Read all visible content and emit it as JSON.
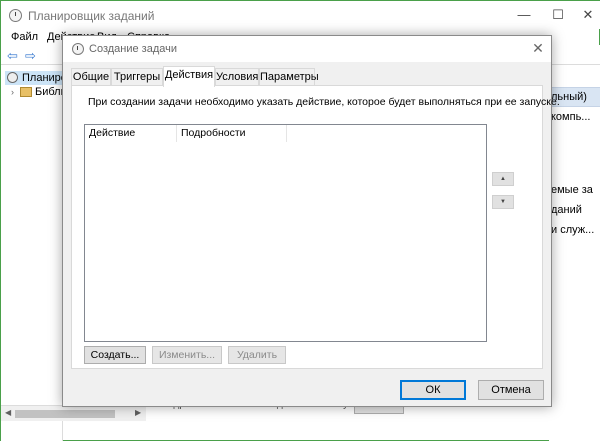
{
  "main_window": {
    "title": "Планировщик заданий",
    "menu": [
      "Файл",
      "Действие",
      "Вид",
      "Справка"
    ],
    "tree_root": "Планировщик",
    "tree_library": "Библиотека",
    "right_pane": {
      "header": "льный)",
      "items": [
        "компь...",
        "емые за",
        "даний",
        "и служ..."
      ]
    },
    "bottom_text": "Подробная статистика о действиях запуска..."
  },
  "dialog": {
    "title": "Создание задачи",
    "tabs": [
      {
        "label": "Общие"
      },
      {
        "label": "Триггеры"
      },
      {
        "label": "Действия"
      },
      {
        "label": "Условия"
      },
      {
        "label": "Параметры"
      }
    ],
    "active_tab": "Действия",
    "description": "При создании задачи необходимо указать действие, которое будет выполняться при ее запуске.",
    "list": {
      "columns": [
        "Действие",
        "Подробности"
      ],
      "rows": []
    },
    "actions": {
      "create": "Создать...",
      "edit": "Изменить...",
      "delete": "Удалить"
    },
    "ok": "ОК",
    "cancel": "Отмена"
  },
  "icons": {
    "up": "move-up-icon",
    "down": "move-down-icon",
    "close": "close-icon"
  },
  "colors": {
    "accent": "#0078d7",
    "tab_panel": "#ffffff",
    "dialog_bg": "#f0f0f0"
  }
}
